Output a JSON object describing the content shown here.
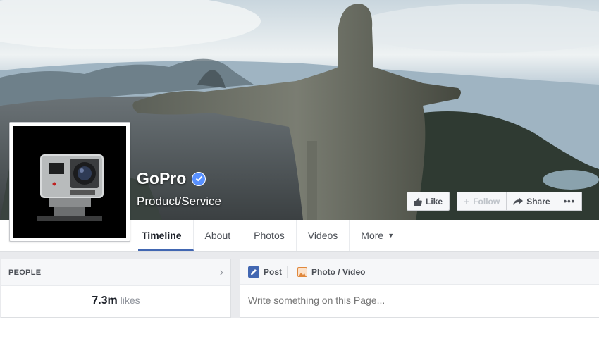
{
  "page": {
    "name": "GoPro",
    "category": "Product/Service"
  },
  "cover_actions": {
    "like_label": "Like",
    "follow_label": "Follow",
    "share_label": "Share",
    "more_label": "•••"
  },
  "nav": {
    "tabs": [
      {
        "label": "Timeline",
        "active": true
      },
      {
        "label": "About"
      },
      {
        "label": "Photos"
      },
      {
        "label": "Videos"
      },
      {
        "label": "More"
      }
    ]
  },
  "people": {
    "title": "PEOPLE",
    "likes_count": "7.3m",
    "likes_label": "likes"
  },
  "composer": {
    "post_label": "Post",
    "photo_label": "Photo / Video",
    "placeholder": "Write something on this Page..."
  },
  "colors": {
    "accent": "#4267b2",
    "verified": "#5890ff",
    "background": "#e9eaed"
  },
  "icons": {
    "verified": "verified-badge-icon",
    "like": "thumbs-up-icon",
    "follow": "plus-icon",
    "share": "share-arrow-icon",
    "post": "pencil-icon",
    "photo": "photo-icon"
  }
}
